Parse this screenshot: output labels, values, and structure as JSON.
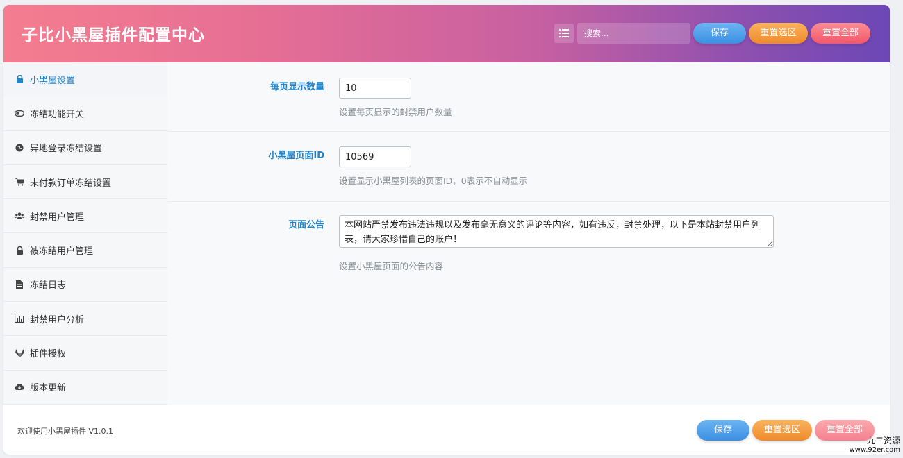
{
  "header": {
    "title": "子比小黑屋插件配置中心",
    "search_placeholder": "搜索...",
    "menu_icon": "list-icon",
    "save_label": "保存",
    "reset_section_label": "重置选区",
    "reset_all_label": "重置全部"
  },
  "sidebar": {
    "items": [
      {
        "label": "小黑屋设置",
        "icon": "lock-icon",
        "active": true
      },
      {
        "label": "冻结功能开关",
        "icon": "toggle-icon"
      },
      {
        "label": "异地登录冻结设置",
        "icon": "globe-icon"
      },
      {
        "label": "未付款订单冻结设置",
        "icon": "cart-icon"
      },
      {
        "label": "封禁用户管理",
        "icon": "users-icon"
      },
      {
        "label": "被冻结用户管理",
        "icon": "lock-icon"
      },
      {
        "label": "冻结日志",
        "icon": "file-icon"
      },
      {
        "label": "封禁用户分析",
        "icon": "bar-chart-icon"
      },
      {
        "label": "插件授权",
        "icon": "gitlab-icon"
      },
      {
        "label": "版本更新",
        "icon": "cloud-download-icon"
      }
    ]
  },
  "fields": [
    {
      "label": "每页显示数量",
      "value": "10",
      "description": "设置每页显示的封禁用户数量"
    },
    {
      "label": "小黑屋页面ID",
      "value": "10569",
      "description": "设置显示小黑屋列表的页面ID，0表示不自动显示"
    },
    {
      "label": "页面公告",
      "value": "本网站严禁发布违法违规以及发布毫无意义的评论等内容，如有违反，封禁处理，以下是本站封禁用户列表，请大家珍惜自己的账户！",
      "description": "设置小黑屋页面的公告内容"
    }
  ],
  "footer": {
    "text": "欢迎使用小黑屋插件 V1.0.1",
    "save_label": "保存",
    "reset_section_label": "重置选区",
    "reset_all_label": "重置全部"
  },
  "watermark": {
    "line1": "九二资源",
    "line2": "www.92er.com"
  },
  "colors": {
    "accent": "#2283c7",
    "header_start": "#f57d8f",
    "header_end": "#6c47b6"
  }
}
